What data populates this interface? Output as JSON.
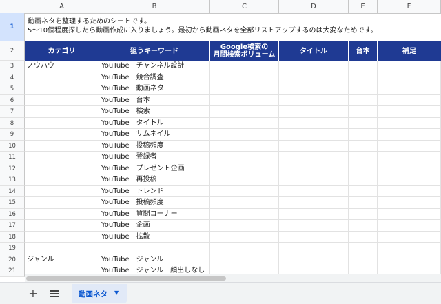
{
  "columns": [
    "A",
    "B",
    "C",
    "D",
    "E",
    "F"
  ],
  "note": {
    "line1": "動画ネタを整理するためのシートです。",
    "line2": "5〜10個程度探したら動画作成に入りましょう。最初から動画ネタを全部リストアップするのは大変なためです。"
  },
  "header": {
    "category": "カテゴリ",
    "keyword": "狙うキーワード",
    "volume_line1": "Google検索の",
    "volume_line2": "月間検索ボリューム",
    "title": "タイトル",
    "script": "台本",
    "notes": "補足"
  },
  "row_numbers": [
    "1",
    "2",
    "3",
    "4",
    "5",
    "6",
    "7",
    "8",
    "9",
    "10",
    "11",
    "12",
    "13",
    "14",
    "15",
    "16",
    "17",
    "18",
    "19",
    "20",
    "21"
  ],
  "rows": [
    {
      "category": "ノウハウ",
      "keyword": "YouTube　チャンネル設計"
    },
    {
      "category": "",
      "keyword": "YouTube　競合調査"
    },
    {
      "category": "",
      "keyword": "YouTube　動画ネタ"
    },
    {
      "category": "",
      "keyword": "YouTube　台本"
    },
    {
      "category": "",
      "keyword": "YouTube　検索"
    },
    {
      "category": "",
      "keyword": "YouTube　タイトル"
    },
    {
      "category": "",
      "keyword": "YouTube　サムネイル"
    },
    {
      "category": "",
      "keyword": "YouTube　投稿頻度"
    },
    {
      "category": "",
      "keyword": "YouTube　登録者"
    },
    {
      "category": "",
      "keyword": "YouTube　プレゼント企画"
    },
    {
      "category": "",
      "keyword": "YouTube　再投稿"
    },
    {
      "category": "",
      "keyword": "YouTube　トレンド"
    },
    {
      "category": "",
      "keyword": "YouTube　投稿頻度"
    },
    {
      "category": "",
      "keyword": "YouTube　質問コーナー"
    },
    {
      "category": "",
      "keyword": "YouTube　企画"
    },
    {
      "category": "",
      "keyword": "YouTube　拡散"
    },
    {
      "category": "",
      "keyword": ""
    },
    {
      "category": "ジャンル",
      "keyword": "YouTube　ジャンル"
    },
    {
      "category": "",
      "keyword": "YouTube　ジャンル　顔出しなし"
    }
  ],
  "tabs": {
    "add_icon": "+",
    "sheet_name": "動画ネタ",
    "caret": "▼"
  },
  "colors": {
    "header_bg": "#1f3a93",
    "header_text": "#ffffff",
    "active_tab": "#0b57d0"
  }
}
